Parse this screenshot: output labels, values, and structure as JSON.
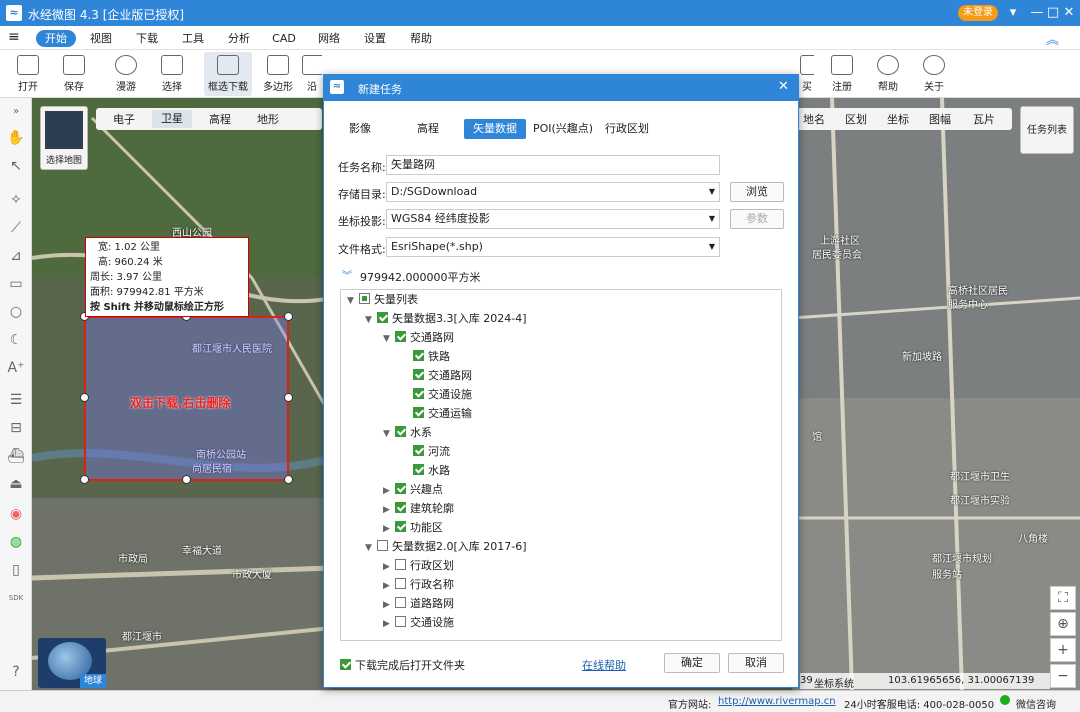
{
  "app": {
    "title": "水经微图 4.3 [企业版已授权]",
    "login": "未登录",
    "logo": "logo-icon"
  },
  "menu": [
    "开始",
    "视图",
    "下载",
    "工具",
    "分析",
    "CAD",
    "网络",
    "设置",
    "帮助"
  ],
  "toolbar": [
    {
      "label": "打开"
    },
    {
      "label": "保存"
    },
    {
      "label": "漫游"
    },
    {
      "label": "选择"
    },
    {
      "label": "框选下载"
    },
    {
      "label": "多边形"
    },
    {
      "label": "沿"
    },
    {
      "label": "买"
    },
    {
      "label": "注册"
    },
    {
      "label": "帮助"
    },
    {
      "label": "关于"
    }
  ],
  "map": {
    "layer_btn": "选择地图",
    "maptypes": [
      "电子",
      "卫星",
      "高程",
      "地形"
    ],
    "overlays": [
      "地名",
      "区划",
      "坐标",
      "图幅",
      "瓦片"
    ],
    "task_list": "任务列表",
    "earth": "地球",
    "info": {
      "width": "宽:  1.02 公里",
      "height": "高:  960.24 米",
      "perimeter": "周长: 3.97 公里",
      "area": "面积: 979942.81 平方米",
      "hint": "按 Shift 并移动鼠标绘正方形"
    },
    "sel_text": "双击下载,右击删除",
    "labels": [
      "西山公园",
      "都江堰市人民医院",
      "南桥公园站",
      "尚居民宿",
      "幸福大道",
      "市政大厦",
      "市政局",
      "都江堰市",
      "馆",
      "都江堰市卫生",
      "都江堰市实验",
      "上游社区",
      "居民委员会",
      "高桥社区居民",
      "服务中心",
      "新加坡路",
      "都江堰市规划",
      "服务站",
      "八角楼"
    ]
  },
  "dialog": {
    "title": "新建任务",
    "tabs": [
      "影像",
      "高程",
      "矢量数据",
      "POI(兴趣点)",
      "行政区划"
    ],
    "fields": {
      "name_label": "任务名称:",
      "name": "矢量路网",
      "dir_label": "存储目录:",
      "dir": "D:/SGDownload",
      "browse": "浏览",
      "crs_label": "坐标投影:",
      "crs": "WGS84 经纬度投影",
      "params": "参数",
      "fmt_label": "文件格式:",
      "fmt": "EsriShape(*.shp)"
    },
    "area": "979942.000000平方米",
    "tree": [
      {
        "label": "矢量列表",
        "lv": 0,
        "state": "part",
        "arrow": "▼"
      },
      {
        "label": "矢量数据3.3[入库 2024-4]",
        "lv": 1,
        "state": "chk",
        "arrow": "▼"
      },
      {
        "label": "交通路网",
        "lv": 2,
        "state": "chk",
        "arrow": "▼"
      },
      {
        "label": "铁路",
        "lv": 3,
        "state": "chk",
        "arrow": ""
      },
      {
        "label": "交通路网",
        "lv": 3,
        "state": "chk",
        "arrow": ""
      },
      {
        "label": "交通设施",
        "lv": 3,
        "state": "chk",
        "arrow": ""
      },
      {
        "label": "交通运输",
        "lv": 3,
        "state": "chk",
        "arrow": ""
      },
      {
        "label": "水系",
        "lv": 2,
        "state": "chk",
        "arrow": "▼"
      },
      {
        "label": "河流",
        "lv": 3,
        "state": "chk",
        "arrow": ""
      },
      {
        "label": "水路",
        "lv": 3,
        "state": "chk",
        "arrow": ""
      },
      {
        "label": "兴趣点",
        "lv": 2,
        "state": "chk",
        "arrow": "▶"
      },
      {
        "label": "建筑轮廓",
        "lv": 2,
        "state": "chk",
        "arrow": "▶"
      },
      {
        "label": "功能区",
        "lv": 2,
        "state": "chk",
        "arrow": "▶"
      },
      {
        "label": "矢量数据2.0[入库 2017-6]",
        "lv": 1,
        "state": "",
        "arrow": "▼"
      },
      {
        "label": "行政区划",
        "lv": 2,
        "state": "",
        "arrow": "▶"
      },
      {
        "label": "行政名称",
        "lv": 2,
        "state": "",
        "arrow": "▶"
      },
      {
        "label": "道路路网",
        "lv": 2,
        "state": "",
        "arrow": "▶"
      },
      {
        "label": "交通设施",
        "lv": 2,
        "state": "",
        "arrow": "▶"
      }
    ],
    "open_folder": "下载完成后打开文件夹",
    "help": "在线帮助",
    "ok": "确定",
    "cancel": "取消"
  },
  "status": {
    "site_label": "官方网站:",
    "site": "http://www.rivermap.cn",
    "hotline": "24小时客服电话: 400-028-0050",
    "coords": "103.61965656, 31.00067139",
    "wechat": "微信咨询",
    "coords_prefix": "39",
    "coord_label": "坐标系统"
  }
}
